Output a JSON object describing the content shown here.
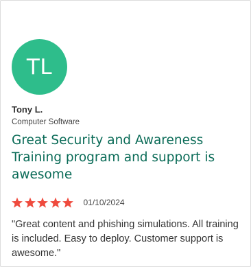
{
  "reviewer": {
    "initials": "TL",
    "name": "Tony L.",
    "industry": "Computer Software",
    "avatar_color": "#2ebd8b"
  },
  "review": {
    "title": "Great Security and Awareness Training program and support is awesome",
    "rating": 5,
    "rating_max": 5,
    "star_color": "#ef4b3e",
    "date": "01/10/2024",
    "body": "\"Great content and phishing simulations. All training is included. Easy to deploy. Customer support is awesome.\""
  }
}
